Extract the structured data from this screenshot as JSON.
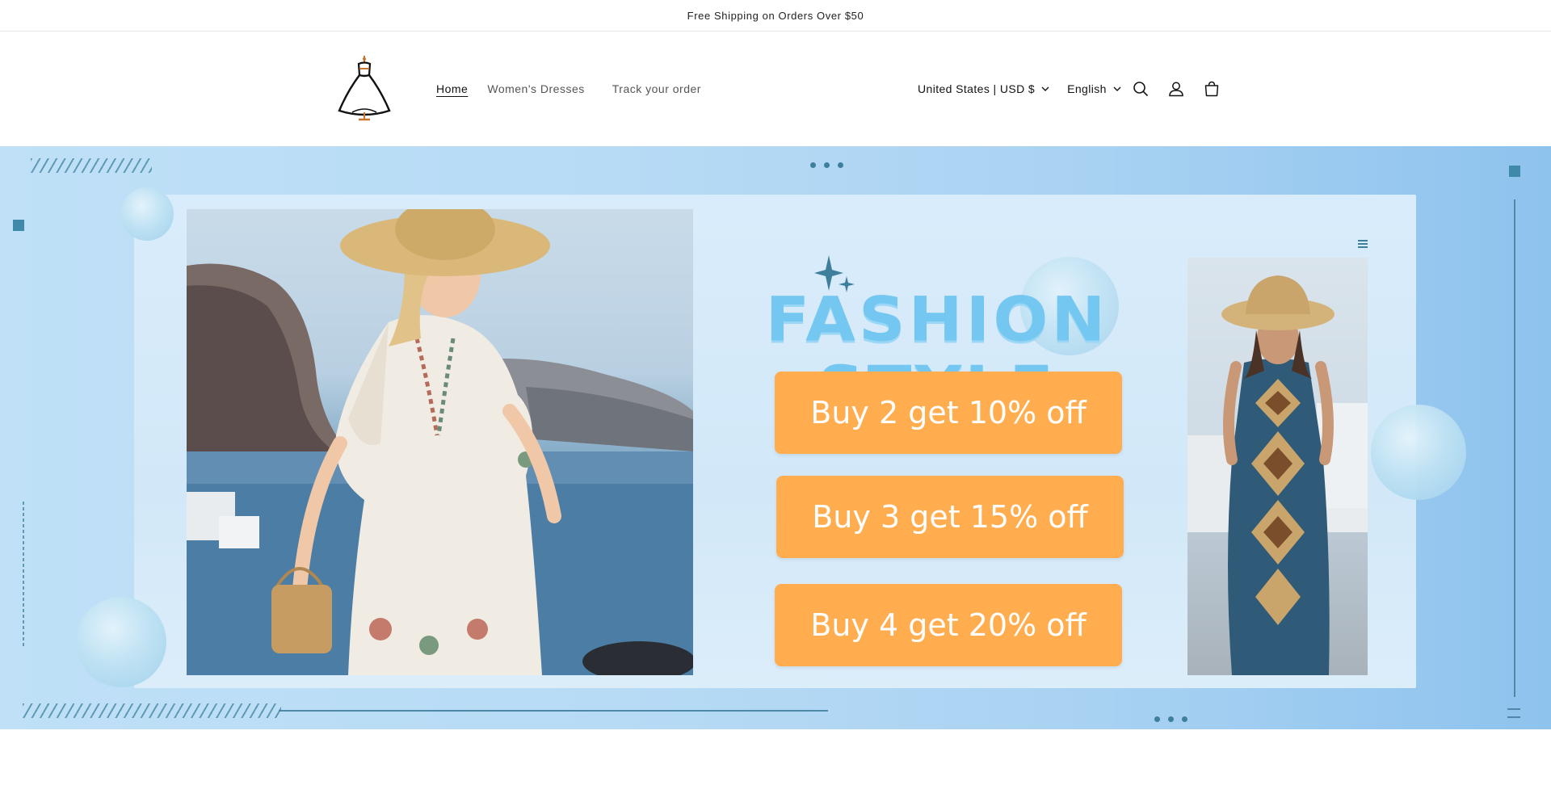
{
  "announcement": {
    "text": "Free Shipping on Orders Over $50"
  },
  "header": {
    "nav": [
      {
        "label": "Home",
        "active": true
      },
      {
        "label": "Women's Dresses",
        "active": false
      },
      {
        "label": "Track your order",
        "active": false
      }
    ],
    "country_selector": {
      "label": "United States | USD $"
    },
    "language_selector": {
      "label": "English"
    },
    "icons": [
      "search-icon",
      "account-icon",
      "cart-icon"
    ]
  },
  "hero": {
    "headline": "FASHION STYLE",
    "offers": [
      {
        "label": "Buy 2 get 10% off"
      },
      {
        "label": "Buy 3 get 15% off"
      },
      {
        "label": "Buy 4 get 20% off"
      }
    ],
    "colors": {
      "background": "#b7dbf5",
      "offer": "#ffad4f",
      "headline": "#74c7f0",
      "accent": "#3f8aa8"
    }
  }
}
